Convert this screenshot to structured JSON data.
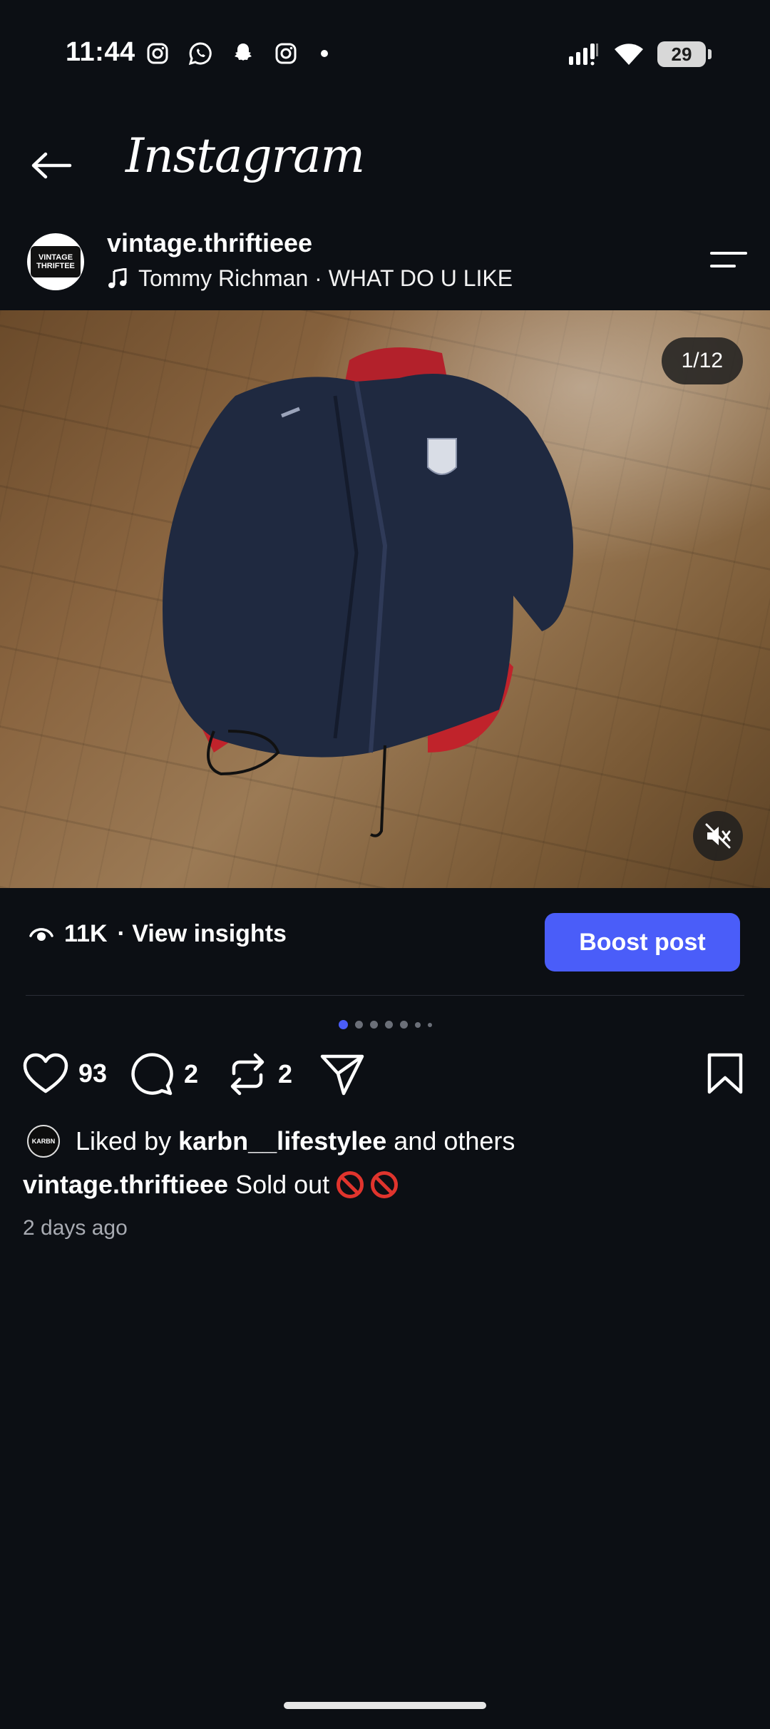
{
  "status_bar": {
    "time": "11:44",
    "battery": "29",
    "notification_icons": [
      "instagram-icon",
      "whatsapp-icon",
      "snapchat-icon",
      "instagram-icon"
    ]
  },
  "header": {
    "title": "Instagram"
  },
  "post": {
    "username": "vintage.thriftieee",
    "audio": "Tommy Richman · WHAT DO U LIKE",
    "avatar_text": "VINTAGE THRIFTEE",
    "image_counter": "1/12",
    "views": "11K",
    "insights_label": "· View insights",
    "boost_label": "Boost post",
    "likes_count": "93",
    "comments_count": "2",
    "reposts_count": "2",
    "liked_by_prefix": "Liked by",
    "liked_by_user": "karbn__lifestylee",
    "liked_by_suffix": "and others",
    "mini_avatar_text": "KARBN",
    "caption_user": "vintage.thriftieee",
    "caption_text": "Sold out",
    "time_ago": "2 days ago"
  },
  "colors": {
    "background": "#0c0f14",
    "accent": "#4a5df9",
    "prohibit": "#e0342d"
  }
}
